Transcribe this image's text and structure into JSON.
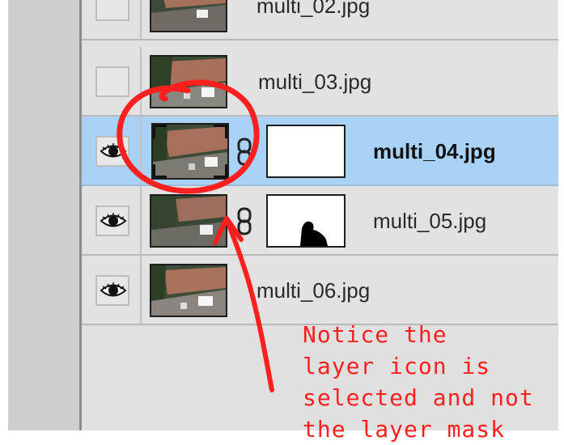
{
  "layers_panel": {
    "layers": [
      {
        "name": "multi_02.jpg",
        "visible": false,
        "selected": false,
        "has_mask": false
      },
      {
        "name": "multi_03.jpg",
        "visible": false,
        "selected": false,
        "has_mask": false
      },
      {
        "name": "multi_04.jpg",
        "visible": true,
        "selected": true,
        "has_mask": true,
        "mask_icon": "blank-mask-icon"
      },
      {
        "name": "multi_05.jpg",
        "visible": true,
        "selected": false,
        "has_mask": true,
        "mask_icon": "silhouette-mask-icon"
      },
      {
        "name": "multi_06.jpg",
        "visible": true,
        "selected": false,
        "has_mask": false
      }
    ],
    "selected_color": "#a8d3f7"
  },
  "annotation": {
    "lines": [
      "Notice the",
      "layer icon is",
      "selected and not",
      "the layer mask"
    ],
    "color": "#ff1f1f"
  }
}
